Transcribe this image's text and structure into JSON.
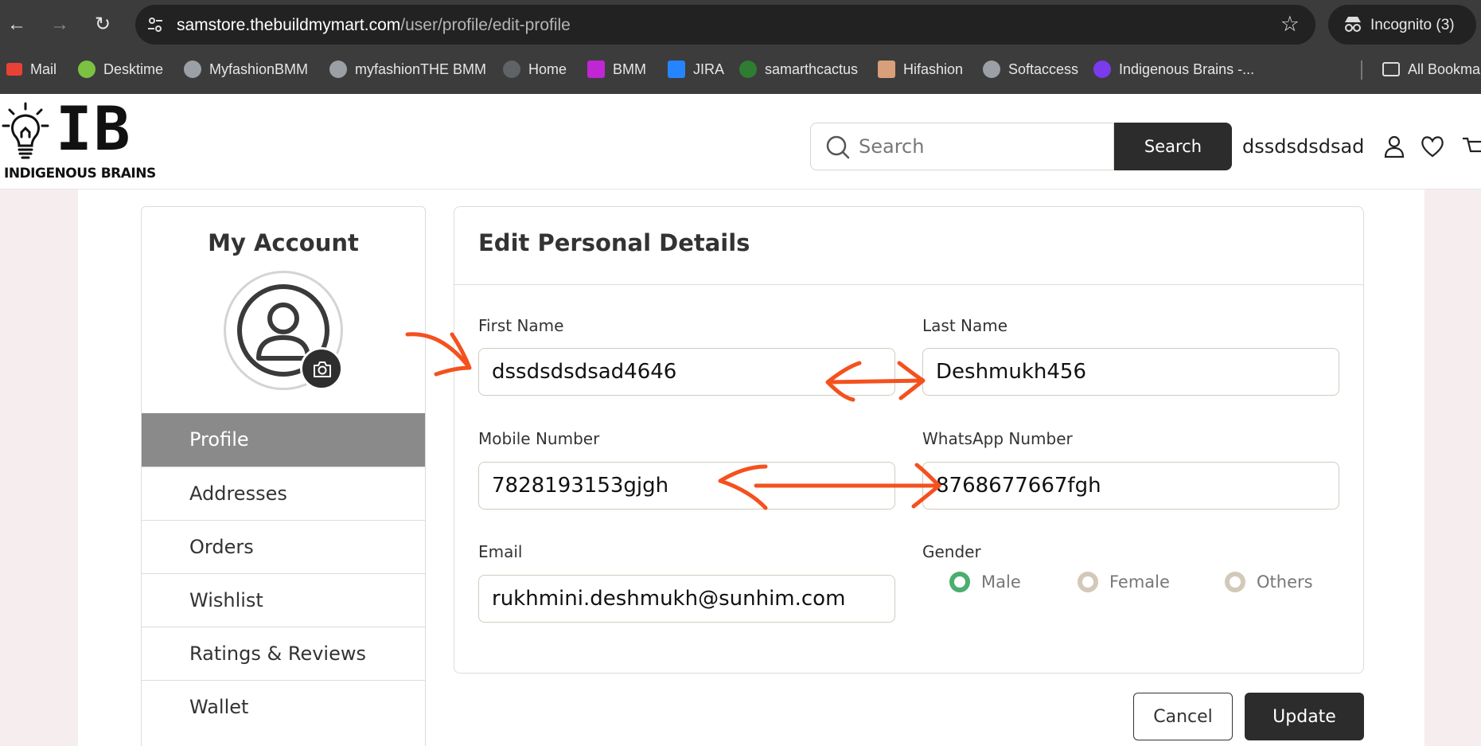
{
  "browser": {
    "url_host": "samstore.thebuildmymart.com",
    "url_path": "/user/profile/edit-profile",
    "incognito_label": "Incognito (3)",
    "bookmarks": [
      {
        "label": "Mail",
        "color": "#e94235"
      },
      {
        "label": "Desktime",
        "color": "#7cc242"
      },
      {
        "label": "MyfashionBMM",
        "color": "#9aa0a6"
      },
      {
        "label": "myfashionTHE BMM",
        "color": "#9aa0a6"
      },
      {
        "label": "Home",
        "color": "#5f6368"
      },
      {
        "label": "BMM",
        "color": "#c026d3"
      },
      {
        "label": "JIRA",
        "color": "#2684ff"
      },
      {
        "label": "samarthcactus",
        "color": "#2e7d32"
      },
      {
        "label": "Hifashion",
        "color": "#d7a07a"
      },
      {
        "label": "Softaccess",
        "color": "#9aa0a6"
      },
      {
        "label": "Indigenous Brains -...",
        "color": "#7c3aed"
      }
    ],
    "all_bookmarks": "All Bookma"
  },
  "header": {
    "logo_letters": "IB",
    "logo_brand": "INDIGENOUS BRAINS",
    "search_placeholder": "Search",
    "search_button": "Search",
    "username": "dssdsdsdsad"
  },
  "sidebar": {
    "title": "My Account",
    "items": [
      {
        "label": "Profile",
        "active": true
      },
      {
        "label": "Addresses"
      },
      {
        "label": "Orders"
      },
      {
        "label": "Wishlist"
      },
      {
        "label": "Ratings & Reviews"
      },
      {
        "label": "Wallet"
      }
    ]
  },
  "form": {
    "title": "Edit Personal Details",
    "first_name": {
      "label": "First Name",
      "value": "dssdsdsdsad4646"
    },
    "last_name": {
      "label": "Last Name",
      "value": "Deshmukh456"
    },
    "mobile": {
      "label": "Mobile Number",
      "value": "7828193153gjgh"
    },
    "whatsapp": {
      "label": "WhatsApp Number",
      "value": "8768677667fgh"
    },
    "email": {
      "label": "Email",
      "value": "rukhmini.deshmukh@sunhim.com"
    },
    "gender": {
      "label": "Gender",
      "options": [
        "Male",
        "Female",
        "Others"
      ],
      "selected": "Male"
    },
    "cancel": "Cancel",
    "update": "Update"
  },
  "colors": {
    "accent_dark": "#2c2c2c",
    "active_menu": "#8a8a8a",
    "radio_selected": "#4cae6e",
    "annotation": "#f4511e"
  }
}
